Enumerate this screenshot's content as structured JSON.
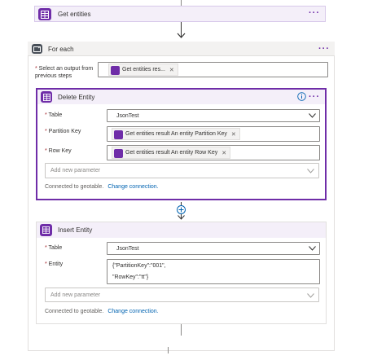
{
  "top_action": {
    "title": "Get entities",
    "menu_icon": "ellipsis-icon"
  },
  "foreach": {
    "title": "For each",
    "select_label": "Select an output from previous steps",
    "select_token": "Get entities res...",
    "menu_icon": "ellipsis-icon"
  },
  "delete_entity": {
    "title": "Delete Entity",
    "info_icon": "info-icon",
    "table_label": "Table",
    "table_value": "JsonTest",
    "partition_label": "Partition Key",
    "partition_token": "Get entities result An entity Partition Key",
    "rowkey_label": "Row Key",
    "rowkey_token": "Get entities result An entity Row Key",
    "add_param": "Add new parameter",
    "connected_text": "Connected to geotable.",
    "change_link": "Change connection."
  },
  "insert_entity": {
    "title": "Insert Entity",
    "table_label": "Table",
    "table_value": "JsonTest",
    "entity_label": "Entity",
    "entity_line1": "{\"PartitionKey\":\"001\",",
    "entity_line2": "\"RowKey\":\"tt\"}",
    "add_param": "Add new parameter",
    "connected_text": "Connected to geotable.",
    "change_link": "Change connection."
  },
  "colors": {
    "accent": "#6f2da8",
    "link": "#0063b1",
    "loop": "#484f58"
  }
}
